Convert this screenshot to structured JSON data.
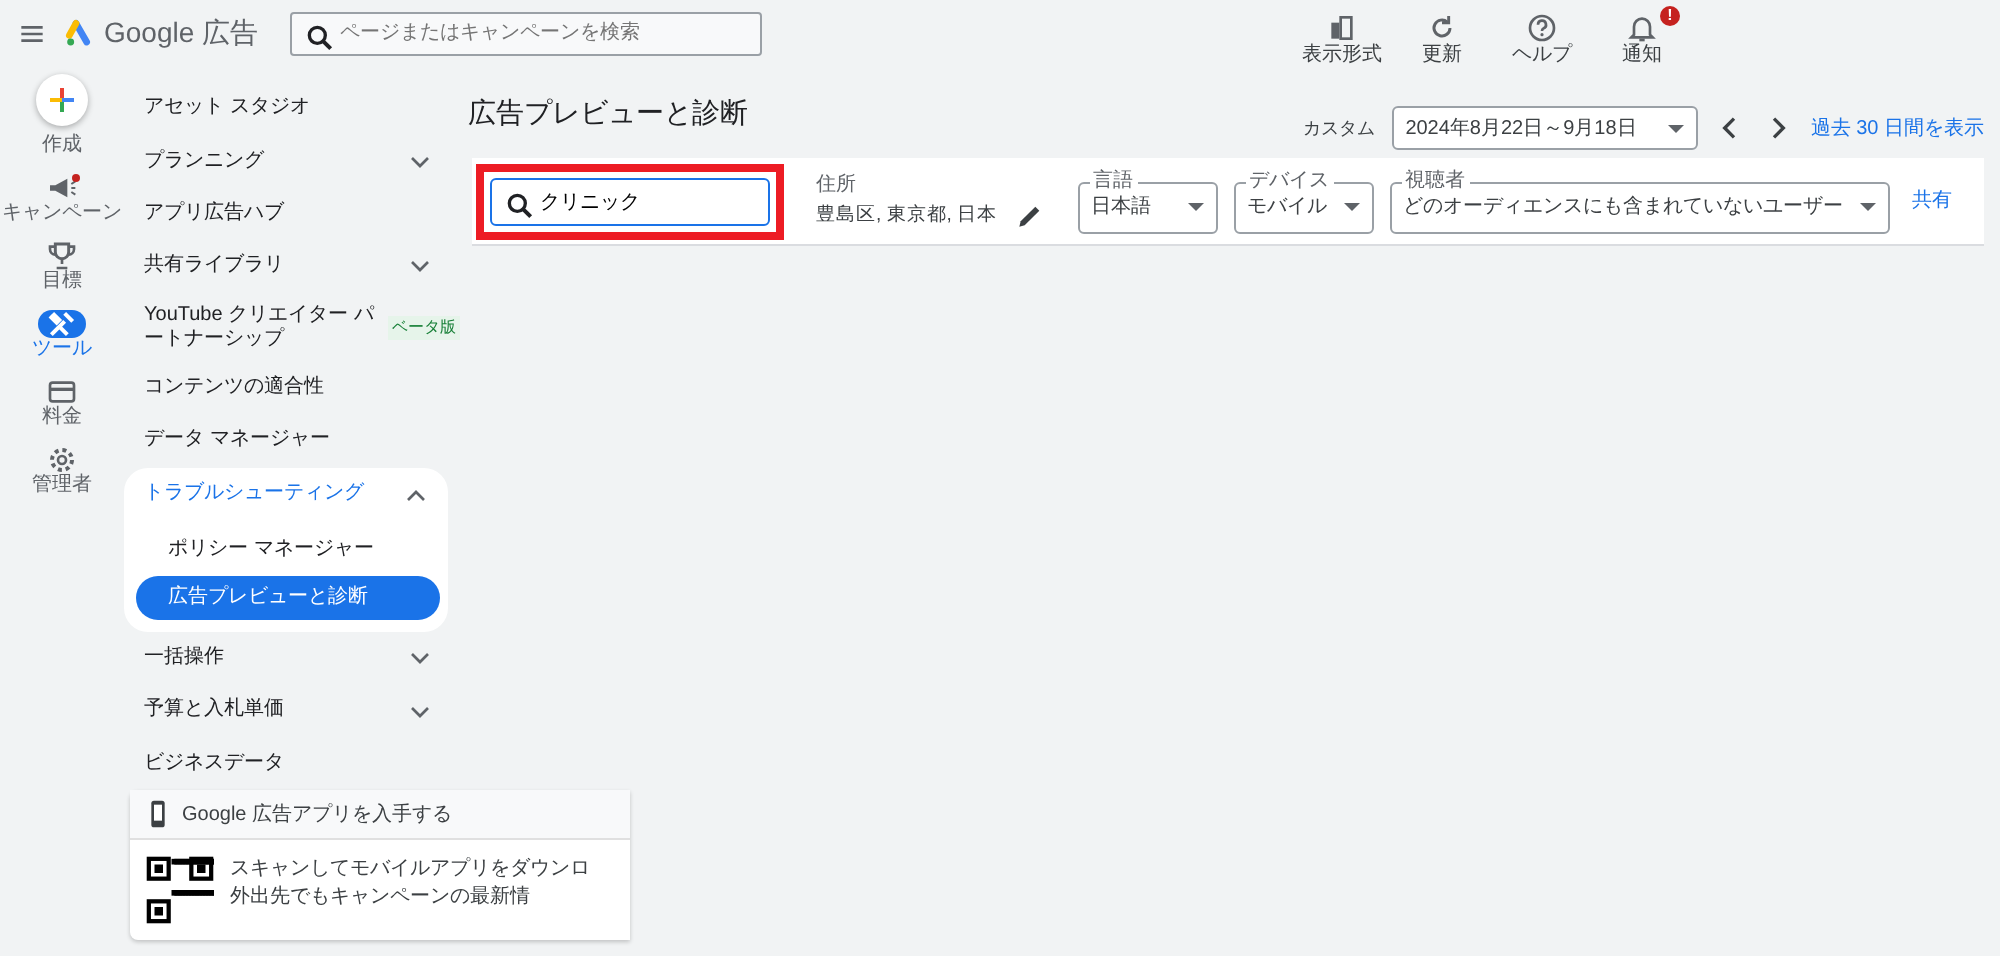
{
  "header": {
    "logo_text": "Google 広告",
    "search": {
      "placeholder": "ページまたはキャンペーンを検索"
    },
    "actions": [
      {
        "kind": "view",
        "label": "表示形式"
      },
      {
        "kind": "refresh",
        "label": "更新"
      },
      {
        "kind": "help",
        "label": "ヘルプ"
      },
      {
        "kind": "bell",
        "label": "通知",
        "badge": "!"
      }
    ]
  },
  "rail": [
    {
      "kind": "create",
      "label": "作成",
      "selected": false,
      "dot": false
    },
    {
      "kind": "campaign",
      "label": "キャンペーン",
      "selected": false,
      "dot": true
    },
    {
      "kind": "goal",
      "label": "目標",
      "selected": false,
      "dot": false
    },
    {
      "kind": "tools",
      "label": "ツール",
      "selected": true,
      "dot": false
    },
    {
      "kind": "billing",
      "label": "料金",
      "selected": false,
      "dot": false
    },
    {
      "kind": "admin",
      "label": "管理者",
      "selected": false,
      "dot": false
    }
  ],
  "sidebar": {
    "items": [
      {
        "label": "アセット スタジオ"
      },
      {
        "label": "プランニング",
        "expanded": false
      },
      {
        "label": "アプリ広告ハブ"
      },
      {
        "label": "共有ライブラリ",
        "expanded": false
      },
      {
        "label": "YouTube クリエイター パートナーシップ",
        "badge": "ベータ版"
      },
      {
        "label": "コンテンツの適合性"
      },
      {
        "label": "データ マネージャー"
      },
      {
        "label": "トラブルシューティング",
        "expanded": true,
        "children": [
          {
            "label": "ポリシー マネージャー",
            "selected": false
          },
          {
            "label": "広告プレビューと診断",
            "selected": true
          }
        ]
      },
      {
        "label": "一括操作",
        "expanded": false
      },
      {
        "label": "予算と入札単価",
        "expanded": false
      },
      {
        "label": "ビジネスデータ"
      }
    ],
    "promo": {
      "title": "Google 広告アプリを入手する",
      "lines": [
        "スキャンしてモバイルアプリをダウンロ",
        "外出先でもキャンペーンの最新情"
      ]
    }
  },
  "page": {
    "title": "広告プレビューと診断",
    "date": {
      "label": "カスタム",
      "range": "2024年8月22日～9月18日",
      "link": "過去 30 日間を表示"
    },
    "filters": {
      "search": {
        "value": "クリニック",
        "highlighted": true
      },
      "location": {
        "label": "住所",
        "value": "豊島区, 東京都, 日本"
      },
      "selects": [
        {
          "label": "言語",
          "value": "日本語"
        },
        {
          "label": "デバイス",
          "value": "モバイル"
        },
        {
          "label": "視聴者",
          "value": "どのオーディエンスにも含まれていないユーザー"
        }
      ],
      "share": "共有"
    }
  }
}
